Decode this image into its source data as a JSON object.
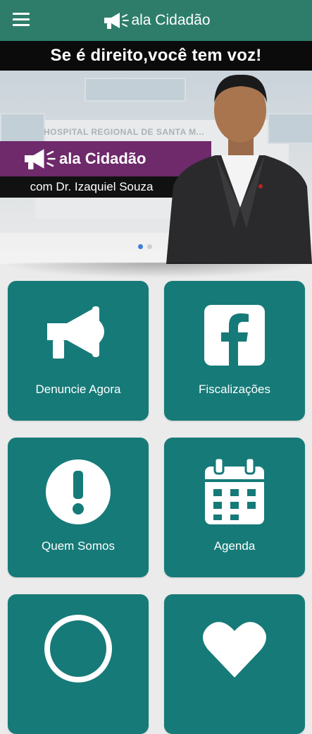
{
  "appbar": {
    "title": "ala Cidadão"
  },
  "banner": {
    "slogan": "Se é direito,você tem voz!",
    "brand": "ala Cidadão",
    "subtitle": "com Dr. Izaquiel Souza",
    "building_sign": "HOSPITAL REGIONAL DE SANTA M...",
    "slides": 2,
    "active_slide": 0
  },
  "tiles": [
    {
      "label": "Denuncie Agora",
      "icon": "megaphone-icon"
    },
    {
      "label": "Fiscalizações",
      "icon": "facebook-icon"
    },
    {
      "label": "Quem Somos",
      "icon": "exclamation-icon"
    },
    {
      "label": "Agenda",
      "icon": "calendar-icon"
    },
    {
      "label": "",
      "icon": "chat-icon"
    },
    {
      "label": "",
      "icon": "heart-icon"
    }
  ],
  "colors": {
    "appbar": "#2e7d6b",
    "tile": "#167a78",
    "brand_strip": "#6e2a6a"
  }
}
